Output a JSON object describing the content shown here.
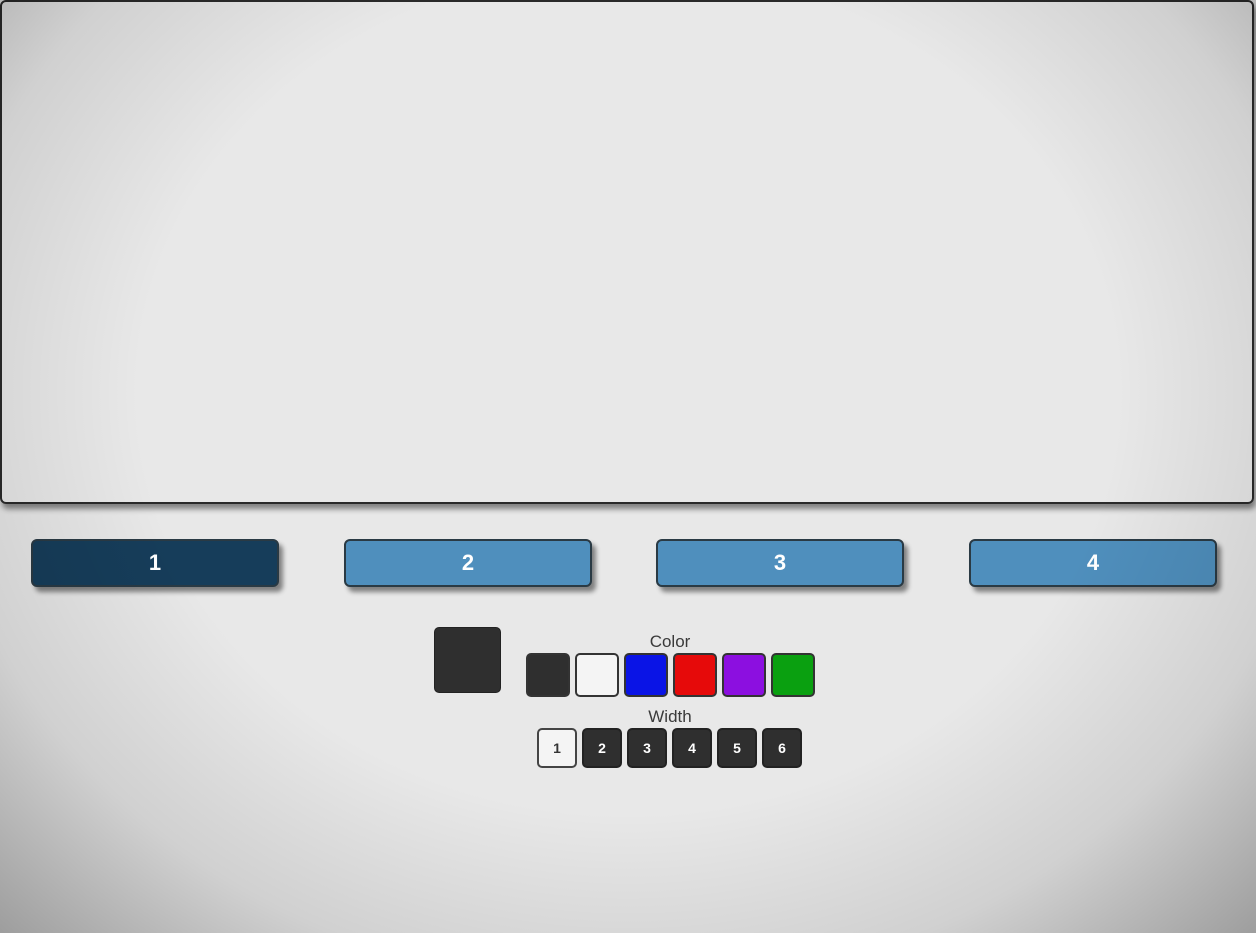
{
  "pages": [
    {
      "label": "1",
      "active": true
    },
    {
      "label": "2",
      "active": false
    },
    {
      "label": "3",
      "active": false
    },
    {
      "label": "4",
      "active": false
    }
  ],
  "colors": {
    "page_active": "#163d5a",
    "page_inactive": "#4f8fbd",
    "current": "#2f2f2f"
  },
  "palette": {
    "label": "Color",
    "swatches": [
      "#2f2f2f",
      "#f4f4f4",
      "#0a14e6",
      "#e60a0a",
      "#8c0fe0",
      "#0aa010"
    ]
  },
  "widths": {
    "label": "Width",
    "options": [
      "1",
      "2",
      "3",
      "4",
      "5",
      "6"
    ],
    "selected": "1"
  }
}
